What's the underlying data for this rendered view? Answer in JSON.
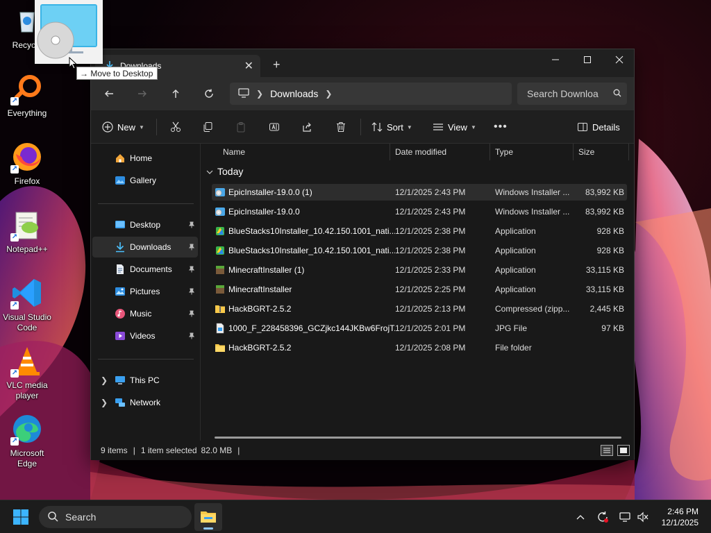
{
  "desktop": {
    "icons": [
      {
        "label": "Recycle"
      },
      {
        "label": "Everything"
      },
      {
        "label": "Firefox"
      },
      {
        "label": "Notepad++"
      },
      {
        "label": "Visual Studio Code"
      },
      {
        "label": "VLC media player"
      },
      {
        "label": "Microsoft Edge"
      }
    ],
    "drag_tooltip": "Move to Desktop"
  },
  "window": {
    "tab_title": "Downloads",
    "address": {
      "location": "Downloads"
    },
    "search": {
      "placeholder": "Search Downloa"
    },
    "toolbar": {
      "new_label": "New",
      "sort_label": "Sort",
      "view_label": "View",
      "details_label": "Details"
    },
    "nav": {
      "home": "Home",
      "gallery": "Gallery",
      "pinned": [
        "Desktop",
        "Downloads",
        "Documents",
        "Pictures",
        "Music",
        "Videos"
      ],
      "this_pc": "This PC",
      "network": "Network"
    },
    "columns": {
      "name": "Name",
      "date": "Date modified",
      "type": "Type",
      "size": "Size"
    },
    "group": "Today",
    "files": [
      {
        "name": "EpicInstaller-19.0.0 (1)",
        "date": "12/1/2025 2:43 PM",
        "type": "Windows Installer ...",
        "size": "83,992 KB",
        "icon": "msi-icon"
      },
      {
        "name": "EpicInstaller-19.0.0",
        "date": "12/1/2025 2:43 PM",
        "type": "Windows Installer ...",
        "size": "83,992 KB",
        "icon": "msi-icon"
      },
      {
        "name": "BlueStacks10Installer_10.42.150.1001_nati...",
        "date": "12/1/2025 2:38 PM",
        "type": "Application",
        "size": "928 KB",
        "icon": "bluestacks-icon"
      },
      {
        "name": "BlueStacks10Installer_10.42.150.1001_nati...",
        "date": "12/1/2025 2:38 PM",
        "type": "Application",
        "size": "928 KB",
        "icon": "bluestacks-icon"
      },
      {
        "name": "MinecraftInstaller (1)",
        "date": "12/1/2025 2:33 PM",
        "type": "Application",
        "size": "33,115 KB",
        "icon": "minecraft-icon"
      },
      {
        "name": "MinecraftInstaller",
        "date": "12/1/2025 2:25 PM",
        "type": "Application",
        "size": "33,115 KB",
        "icon": "minecraft-icon"
      },
      {
        "name": "HackBGRT-2.5.2",
        "date": "12/1/2025 2:13 PM",
        "type": "Compressed (zipp...",
        "size": "2,445 KB",
        "icon": "zip-folder-icon"
      },
      {
        "name": "1000_F_228458396_GCZjkc144JKBw6FrojT...",
        "date": "12/1/2025 2:01 PM",
        "type": "JPG File",
        "size": "97 KB",
        "icon": "jpg-file-icon"
      },
      {
        "name": "HackBGRT-2.5.2",
        "date": "12/1/2025 2:08 PM",
        "type": "File folder",
        "size": "",
        "icon": "folder-icon"
      }
    ],
    "status": {
      "items": "9 items",
      "selected": "1 item selected",
      "size": "82.0 MB"
    }
  },
  "taskbar": {
    "search_label": "Search",
    "time": "2:46 PM",
    "date": "12/1/2025"
  },
  "colors": {
    "accent": "#4cc2ff",
    "folder": "#f8c94a",
    "bg": "#191919"
  }
}
